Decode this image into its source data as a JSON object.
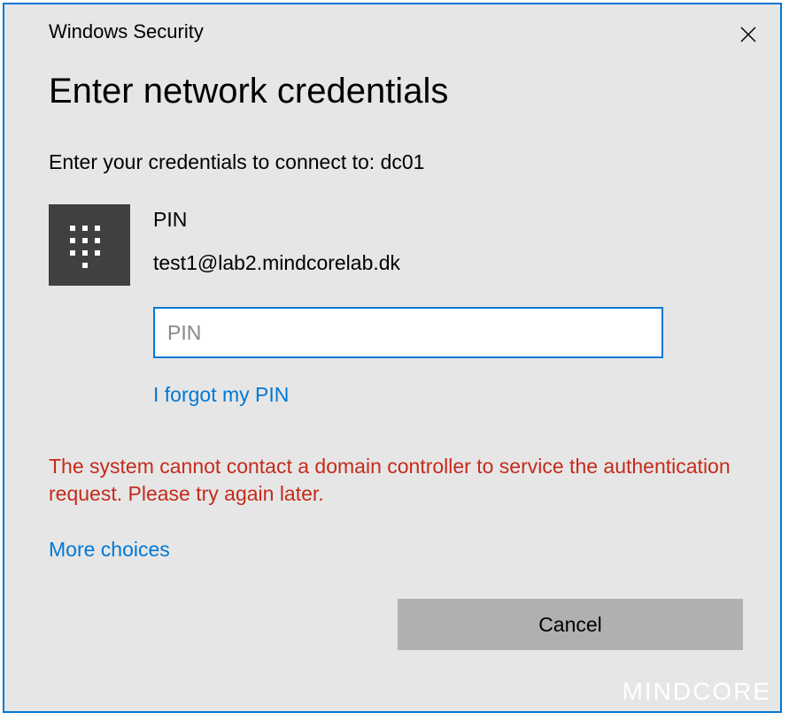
{
  "titlebar": {
    "title": "Windows Security"
  },
  "heading": "Enter network credentials",
  "subheading": "Enter your credentials to connect to: dc01",
  "credential": {
    "method_label": "PIN",
    "username": "test1@lab2.mindcorelab.dk"
  },
  "pin_input": {
    "placeholder": "PIN",
    "value": ""
  },
  "forgot_link": "I forgot my PIN",
  "error_message": "The system cannot contact a domain controller to service the authentication request. Please try again later.",
  "more_choices": "More choices",
  "buttons": {
    "cancel": "Cancel"
  },
  "watermark": "MINDCORE",
  "colors": {
    "accent": "#0078d4",
    "error": "#c42b1c",
    "dialog_bg": "#e6e6e6",
    "button_bg": "#b0b0b0"
  }
}
